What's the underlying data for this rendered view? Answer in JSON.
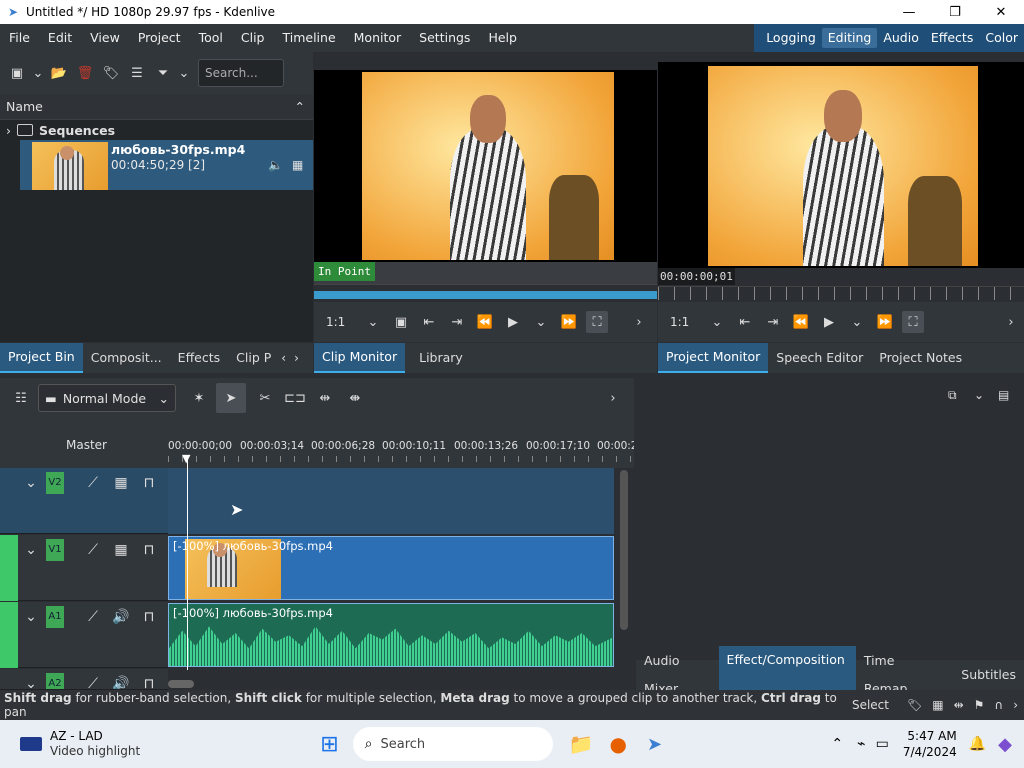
{
  "window": {
    "title": "Untitled */ HD 1080p 29.97 fps - Kdenlive"
  },
  "menu": [
    "File",
    "Edit",
    "View",
    "Project",
    "Tool",
    "Clip",
    "Timeline",
    "Monitor",
    "Settings",
    "Help"
  ],
  "workspaces": [
    "Logging",
    "Editing",
    "Audio",
    "Effects",
    "Color"
  ],
  "active_workspace": "Editing",
  "bin": {
    "search_placeholder": "Search...",
    "header": "Name",
    "folder": "Sequences",
    "clip_name": "любовь-30fps.mp4",
    "clip_info": "00:04:50;29 [2]"
  },
  "left_tabs": [
    "Project Bin",
    "Composit...",
    "Effects",
    "Clip P"
  ],
  "clip_monitor": {
    "zoom": "1:1",
    "in_point": "In Point",
    "tabs": [
      "Clip Monitor",
      "Library"
    ]
  },
  "project_monitor": {
    "zoom": "1:1",
    "timecode": "00:00:00;01",
    "tabs": [
      "Project Monitor",
      "Speech Editor",
      "Project Notes"
    ]
  },
  "timeline": {
    "mode": "Normal Mode",
    "master": "Master",
    "ticks": [
      "00:00:00;00",
      "00:00:03;14",
      "00:00:06;28",
      "00:00:10;11",
      "00:00:13;26",
      "00:00:17;10",
      "00:00:2"
    ],
    "tracks": {
      "v2": "V2",
      "v1": "V1",
      "a1": "A1",
      "a2": "A2"
    },
    "video_clip": "[-100%] любовь-30fps.mp4",
    "audio_clip": "[-100%] любовь-30fps.mp4"
  },
  "right_tabs": [
    "Audio Mixer",
    "Effect/Composition ...",
    "Time Remap...",
    "Subtitles"
  ],
  "status": {
    "p1b": "Shift drag",
    "p1": " for rubber-band selection, ",
    "p2b": "Shift click",
    "p2": " for multiple selection, ",
    "p3b": "Meta drag",
    "p3": " to move a grouped clip to another track, ",
    "p4b": "Ctrl drag",
    "p4": " to pan",
    "tool": "Select"
  },
  "taskbar": {
    "news_title": "AZ - LAD",
    "news_sub": "Video highlight",
    "search": "Search",
    "time": "5:47 AM",
    "date": "7/4/2024"
  }
}
